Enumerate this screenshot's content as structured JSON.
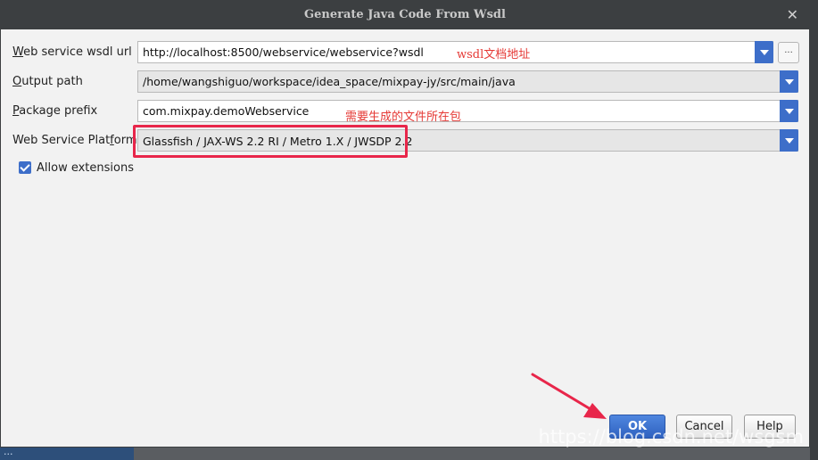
{
  "window": {
    "title": "Generate Java Code From Wsdl",
    "close_glyph": "✕"
  },
  "form": {
    "wsdl_url": {
      "label_mnemonic": "W",
      "label_rest": "eb service wsdl url",
      "value": "http://localhost:8500/webservice/webservice?wsdl"
    },
    "output_path": {
      "label_mnemonic": "O",
      "label_rest": "utput path",
      "value": "/home/wangshiguo/workspace/idea_space/mixpay-jy/src/main/java"
    },
    "package_prefix": {
      "label_mnemonic": "P",
      "label_rest": "ackage prefix",
      "value": "com.mixpay.demoWebservice"
    },
    "platform": {
      "label_pre": "Web Service Plat",
      "label_mnemonic": "f",
      "label_post": "orm",
      "value": "Glassfish / JAX-WS 2.2 RI / Metro 1.X / JWSDP 2.2"
    },
    "allow_extensions": {
      "label": "Allow extensions",
      "checked": true
    },
    "browse_label": "..."
  },
  "annotations": {
    "wsdl_note": "wsdl文档地址",
    "package_note": "需要生成的文件所在包"
  },
  "buttons": {
    "ok": "OK",
    "cancel": "Cancel",
    "help": "Help"
  },
  "watermark": "https://blog.csdn.net/wsgsm",
  "background_text": "...",
  "colors": {
    "accent": "#3d6ec9",
    "annotation": "#e53935",
    "highlight": "#e8264a",
    "titlebar": "#3c3f41"
  }
}
